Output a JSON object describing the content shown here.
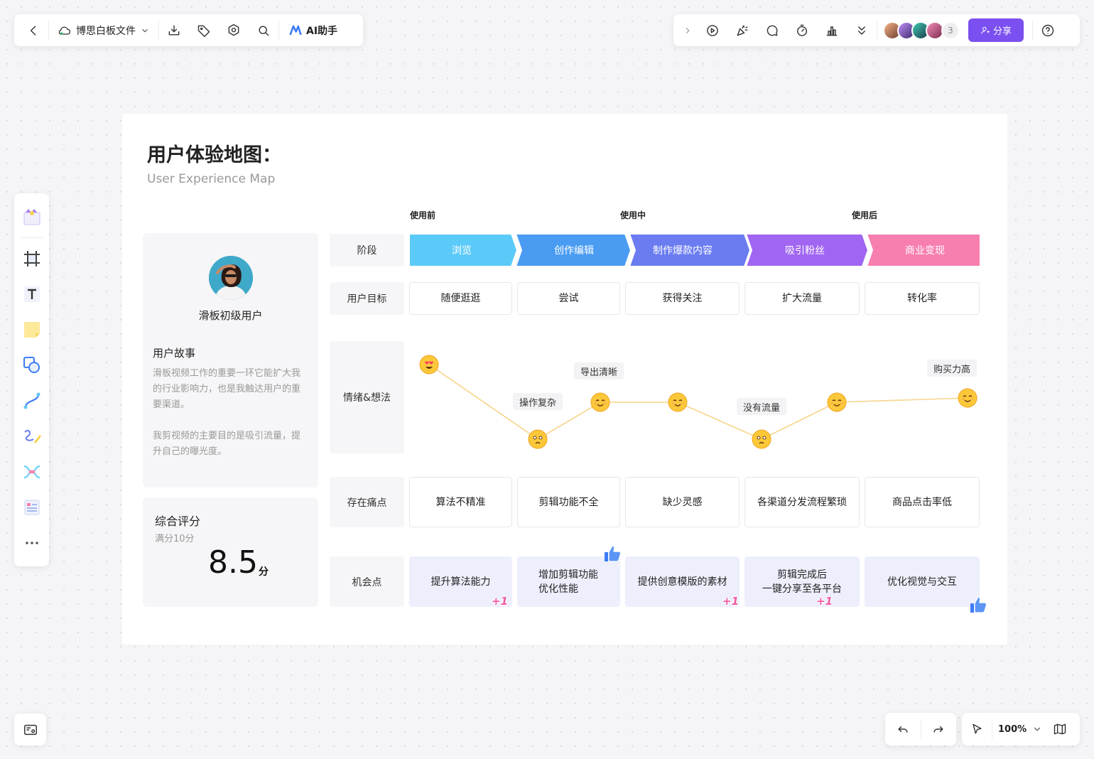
{
  "toolbar": {
    "doc_title": "博思白板文件",
    "ai_label": "AI助手",
    "share_label": "分享",
    "collaborator_count": "3"
  },
  "zoom": {
    "level": "100%"
  },
  "map": {
    "title": "用户体验地图：",
    "subtitle": "User Experience Map",
    "phases": [
      "使用前",
      "使用中",
      "使用后"
    ],
    "user": {
      "name": "滑板初级用户",
      "story_title": "用户故事",
      "story_p1": "滑板视频工作的重要一环它能扩大我的行业影响力，也是我触达用户的重要渠道。",
      "story_p2": "我剪视频的主要目的是吸引流量，提升自己的曝光度。"
    },
    "score": {
      "title": "综合评分",
      "subtitle": "满分10分",
      "value": "8.5",
      "unit": "分"
    },
    "row_labels": {
      "stage": "阶段",
      "goal": "用户目标",
      "emotion": "情绪&想法",
      "pain": "存在痛点",
      "opportunity": "机会点"
    },
    "stages": [
      {
        "label": "浏览",
        "color": "#5ccaf8"
      },
      {
        "label": "创作编辑",
        "color": "#4a9cf2"
      },
      {
        "label": "制作爆款内容",
        "color": "#6a7cf0"
      },
      {
        "label": "吸引粉丝",
        "color": "#a066f2"
      },
      {
        "label": "商业变现",
        "color": "#f77fb0"
      }
    ],
    "goals": [
      "随便逛逛",
      "尝试",
      "获得关注",
      "扩大流量",
      "转化率"
    ],
    "emotions": {
      "tags": [
        "操作复杂",
        "导出清晰",
        "没有流量",
        "购买力高"
      ],
      "points": [
        {
          "mood": "love"
        },
        {
          "mood": "sad"
        },
        {
          "mood": "happy"
        },
        {
          "mood": "happy"
        },
        {
          "mood": "sad"
        },
        {
          "mood": "happy"
        },
        {
          "mood": "happy"
        }
      ]
    },
    "pains": [
      "算法不精准",
      "剪辑功能不全",
      "缺少灵感",
      "各渠道分发流程繁琐",
      "商品点击率低"
    ],
    "opportunities": [
      {
        "label": "提升算法能力"
      },
      {
        "label": "增加剪辑功能\n优化性能"
      },
      {
        "label": "提供创意模版的素材"
      },
      {
        "label": "剪辑完成后\n一键分享至各平台"
      },
      {
        "label": "优化视觉与交互"
      }
    ],
    "plus_one": "+1"
  },
  "colors": {
    "accent": "#7b4ff0",
    "line": "#f7d48a"
  }
}
